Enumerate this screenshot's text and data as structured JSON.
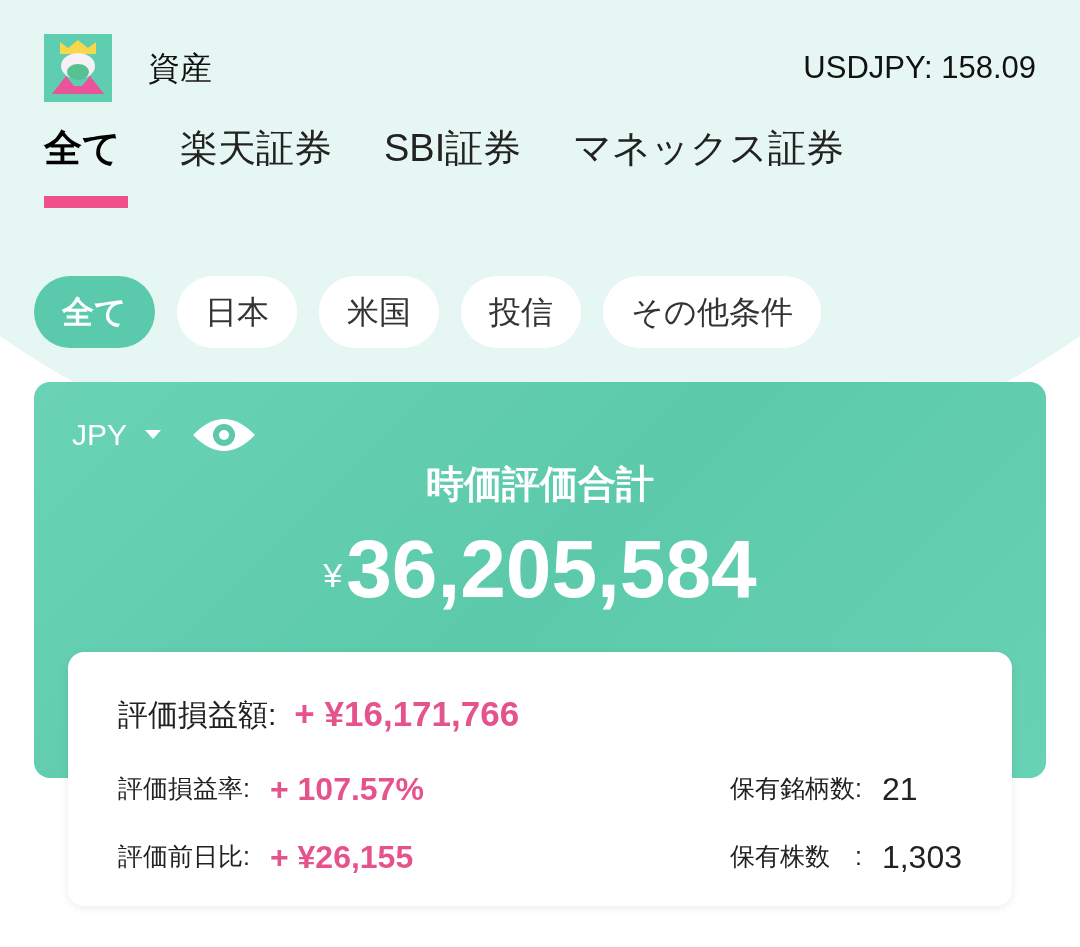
{
  "header": {
    "title": "資産",
    "rate": "USDJPY: 158.09"
  },
  "tabs": [
    {
      "label": "全て",
      "selected": true
    },
    {
      "label": "楽天証券",
      "selected": false
    },
    {
      "label": "SBI証券",
      "selected": false
    },
    {
      "label": "マネックス証券",
      "selected": false
    }
  ],
  "filters": [
    {
      "label": "全て",
      "selected": true
    },
    {
      "label": "日本",
      "selected": false
    },
    {
      "label": "米国",
      "selected": false
    },
    {
      "label": "投信",
      "selected": false
    },
    {
      "label": "その他条件",
      "selected": false
    }
  ],
  "summary": {
    "currency": "JPY",
    "title": "時価評価合計",
    "currency_mark": "¥",
    "total": "36,205,584"
  },
  "profit": {
    "label": "評価損益額",
    "colon": ":",
    "value": "+ ¥16,171,766"
  },
  "stats": [
    {
      "label": "評価損益率",
      "colon": ":",
      "value": "+ 107.57%",
      "kind": "gain"
    },
    {
      "label": "保有銘柄数",
      "colon": ":",
      "value": "21",
      "kind": "plain"
    },
    {
      "label": "評価前日比",
      "colon": ":",
      "value": "+ ¥26,155",
      "kind": "gain"
    },
    {
      "label": "保有株数",
      "colon": ":",
      "value": "1,303",
      "kind": "plain"
    }
  ]
}
